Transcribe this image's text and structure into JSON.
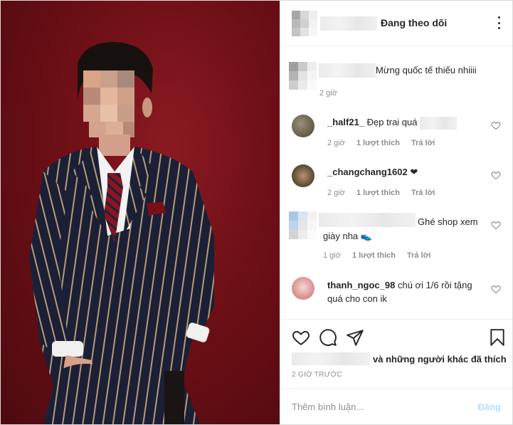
{
  "header": {
    "follow_status": "Đang theo dõi",
    "more_icon": "more-horizontal-icon"
  },
  "caption": {
    "text": "Mừng quốc tế thiếu nhiiii",
    "time": "2 giờ"
  },
  "comments": [
    {
      "username": "_half21_",
      "text": "Đẹp trai quá",
      "time": "2 giờ",
      "likes": "1 lượt thích",
      "reply": "Trả lời"
    },
    {
      "username": "_changchang1602",
      "text": "❤",
      "time": "2 giờ",
      "likes": "1 lượt thích",
      "reply": "Trả lời"
    },
    {
      "username": "",
      "text": "Ghé shop xem giày nha 👟",
      "time": "1 giờ",
      "likes": "1 lượt thích",
      "reply": "Trả lời"
    },
    {
      "username": "thanh_ngoc_98",
      "text": "chú ơi 1/6 rồi tặng quá cho con ik",
      "time": "",
      "likes": "",
      "reply": ""
    }
  ],
  "actions": {
    "like_icon": "heart-icon",
    "comment_icon": "comment-icon",
    "share_icon": "send-icon",
    "save_icon": "bookmark-icon",
    "likes_suffix": "và những người khác đã thích",
    "timestamp": "2 GIỜ TRƯỚC",
    "comment_placeholder": "Thêm bình luận...",
    "post_label": "Đăng"
  },
  "colors": {
    "background_red": "#6e0f16",
    "text_dark": "#262626",
    "text_gray": "#8e8e8e",
    "post_disabled": "#b2dffc"
  }
}
